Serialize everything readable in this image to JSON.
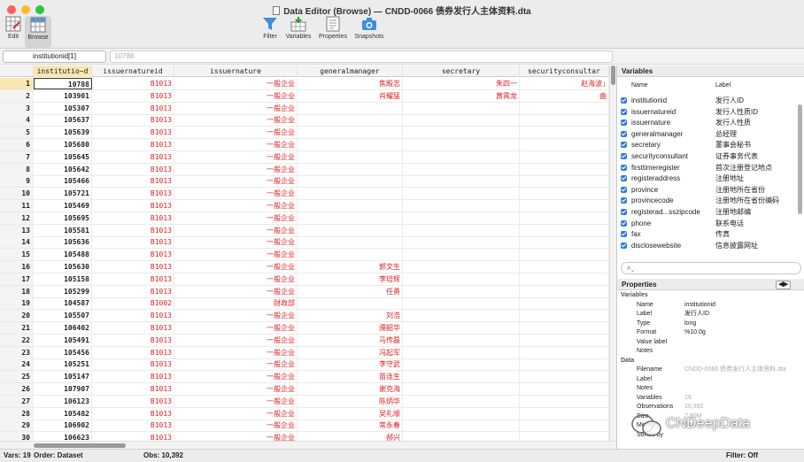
{
  "window": {
    "title": "Data Editor (Browse) — CNDD-0066 债券发行人主体资料.dta"
  },
  "toolbar": {
    "edit": "Edit",
    "browse": "Browse",
    "filter": "Filter",
    "variables": "Variables",
    "properties": "Properties",
    "snapshots": "Snapshots"
  },
  "command": {
    "varname": "institutionid[1]",
    "value": "10788"
  },
  "columns": [
    "institutio~d",
    "issuernatureid",
    "issuernature",
    "generalmanager",
    "secretary",
    "securityconsultar"
  ],
  "rows": [
    {
      "n": "1",
      "c": [
        "10788",
        "B1013",
        "一般企业",
        "焦殿志",
        "朱四一",
        "赵海波;"
      ]
    },
    {
      "n": "2",
      "c": [
        "103901",
        "B1013",
        "一般企业",
        "肖耀猛",
        "黄霄龙",
        "曲"
      ]
    },
    {
      "n": "3",
      "c": [
        "105307",
        "B1013",
        "一般企业",
        "",
        "",
        ""
      ]
    },
    {
      "n": "4",
      "c": [
        "105637",
        "B1013",
        "一般企业",
        "",
        "",
        ""
      ]
    },
    {
      "n": "5",
      "c": [
        "105639",
        "B1013",
        "一般企业",
        "",
        "",
        ""
      ]
    },
    {
      "n": "6",
      "c": [
        "105680",
        "B1013",
        "一般企业",
        "",
        "",
        ""
      ]
    },
    {
      "n": "7",
      "c": [
        "105645",
        "B1013",
        "一般企业",
        "",
        "",
        ""
      ]
    },
    {
      "n": "8",
      "c": [
        "105642",
        "B1013",
        "一般企业",
        "",
        "",
        ""
      ]
    },
    {
      "n": "9",
      "c": [
        "105466",
        "B1013",
        "一般企业",
        "",
        "",
        ""
      ]
    },
    {
      "n": "10",
      "c": [
        "105721",
        "B1013",
        "一般企业",
        "",
        "",
        ""
      ]
    },
    {
      "n": "11",
      "c": [
        "105469",
        "B1013",
        "一般企业",
        "",
        "",
        ""
      ]
    },
    {
      "n": "12",
      "c": [
        "105695",
        "B1013",
        "一般企业",
        "",
        "",
        ""
      ]
    },
    {
      "n": "13",
      "c": [
        "105581",
        "B1013",
        "一般企业",
        "",
        "",
        ""
      ]
    },
    {
      "n": "14",
      "c": [
        "105636",
        "B1013",
        "一般企业",
        "",
        "",
        ""
      ]
    },
    {
      "n": "15",
      "c": [
        "105488",
        "B1013",
        "一般企业",
        "",
        "",
        ""
      ]
    },
    {
      "n": "16",
      "c": [
        "105630",
        "B1013",
        "一般企业",
        "郭文生",
        "",
        ""
      ]
    },
    {
      "n": "17",
      "c": [
        "105158",
        "B1013",
        "一般企业",
        "李培辉",
        "",
        ""
      ]
    },
    {
      "n": "18",
      "c": [
        "105299",
        "B1013",
        "一般企业",
        "任勇",
        "",
        ""
      ]
    },
    {
      "n": "19",
      "c": [
        "104587",
        "B1002",
        "财政部",
        "",
        "",
        ""
      ]
    },
    {
      "n": "20",
      "c": [
        "105507",
        "B1013",
        "一般企业",
        "刘浩",
        "",
        ""
      ]
    },
    {
      "n": "21",
      "c": [
        "106402",
        "B1013",
        "一般企业",
        "濮韶华",
        "",
        ""
      ]
    },
    {
      "n": "22",
      "c": [
        "105491",
        "B1013",
        "一般企业",
        "马传磊",
        "",
        ""
      ]
    },
    {
      "n": "23",
      "c": [
        "105456",
        "B1013",
        "一般企业",
        "冯起军",
        "",
        ""
      ]
    },
    {
      "n": "24",
      "c": [
        "105251",
        "B1013",
        "一般企业",
        "李守武",
        "",
        ""
      ]
    },
    {
      "n": "25",
      "c": [
        "105147",
        "B1013",
        "一般企业",
        "苗连生",
        "",
        ""
      ]
    },
    {
      "n": "26",
      "c": [
        "107907",
        "B1013",
        "一般企业",
        "谢克海",
        "",
        ""
      ]
    },
    {
      "n": "27",
      "c": [
        "106123",
        "B1013",
        "一般企业",
        "陈炳华",
        "",
        ""
      ]
    },
    {
      "n": "28",
      "c": [
        "105482",
        "B1013",
        "一般企业",
        "吴礼顺",
        "",
        ""
      ]
    },
    {
      "n": "29",
      "c": [
        "106902",
        "B1013",
        "一般企业",
        "常永春",
        "",
        ""
      ]
    },
    {
      "n": "30",
      "c": [
        "106623",
        "B1013",
        "一般企业",
        "郝兴",
        "",
        ""
      ]
    }
  ],
  "status": {
    "vars": "Vars: 19",
    "order": "Order: Dataset",
    "obs": "Obs: 10,392",
    "filter": "Filter: Off"
  },
  "variables_panel": {
    "title": "Variables",
    "col_name": "Name",
    "col_label": "Label",
    "items": [
      {
        "name": "institutionid",
        "label": "发行人ID"
      },
      {
        "name": "issuernatureid",
        "label": "发行人性质ID"
      },
      {
        "name": "issuernature",
        "label": "发行人性质"
      },
      {
        "name": "generalmanager",
        "label": "总经理"
      },
      {
        "name": "secretary",
        "label": "董事会秘书"
      },
      {
        "name": "securityconsultant",
        "label": "证券事务代表"
      },
      {
        "name": "firsttimeregister",
        "label": "首次注册登记地点"
      },
      {
        "name": "registeraddress",
        "label": "注册地址"
      },
      {
        "name": "province",
        "label": "注册地所在省份"
      },
      {
        "name": "provincecode",
        "label": "注册地所在省份编码"
      },
      {
        "name": "registerad...sszipcode",
        "label": "注册地邮编"
      },
      {
        "name": "phone",
        "label": "联系电话"
      },
      {
        "name": "fax",
        "label": "传真"
      },
      {
        "name": "disclosewebsite",
        "label": "信息披露网址"
      }
    ]
  },
  "properties_panel": {
    "title": "Properties",
    "group_variables": "Variables",
    "group_data": "Data",
    "var_props": [
      {
        "k": "Name",
        "v": "institutionid"
      },
      {
        "k": "Label",
        "v": "发行人ID"
      },
      {
        "k": "Type",
        "v": "long"
      },
      {
        "k": "Format",
        "v": "%10.0g"
      },
      {
        "k": "Value label",
        "v": ""
      },
      {
        "k": "Notes",
        "v": ""
      }
    ],
    "data_props": [
      {
        "k": "Filename",
        "v": "CNDD-0066 债券发行人主体资料.dta"
      },
      {
        "k": "Label",
        "v": ""
      },
      {
        "k": "Notes",
        "v": ""
      },
      {
        "k": "Variables",
        "v": "19"
      },
      {
        "k": "Observations",
        "v": "10,392"
      },
      {
        "k": "Size",
        "v": "7.90M"
      },
      {
        "k": "Memory",
        "v": "64M"
      },
      {
        "k": "Sorted by",
        "v": ""
      }
    ]
  },
  "watermark": "CNDeepData"
}
